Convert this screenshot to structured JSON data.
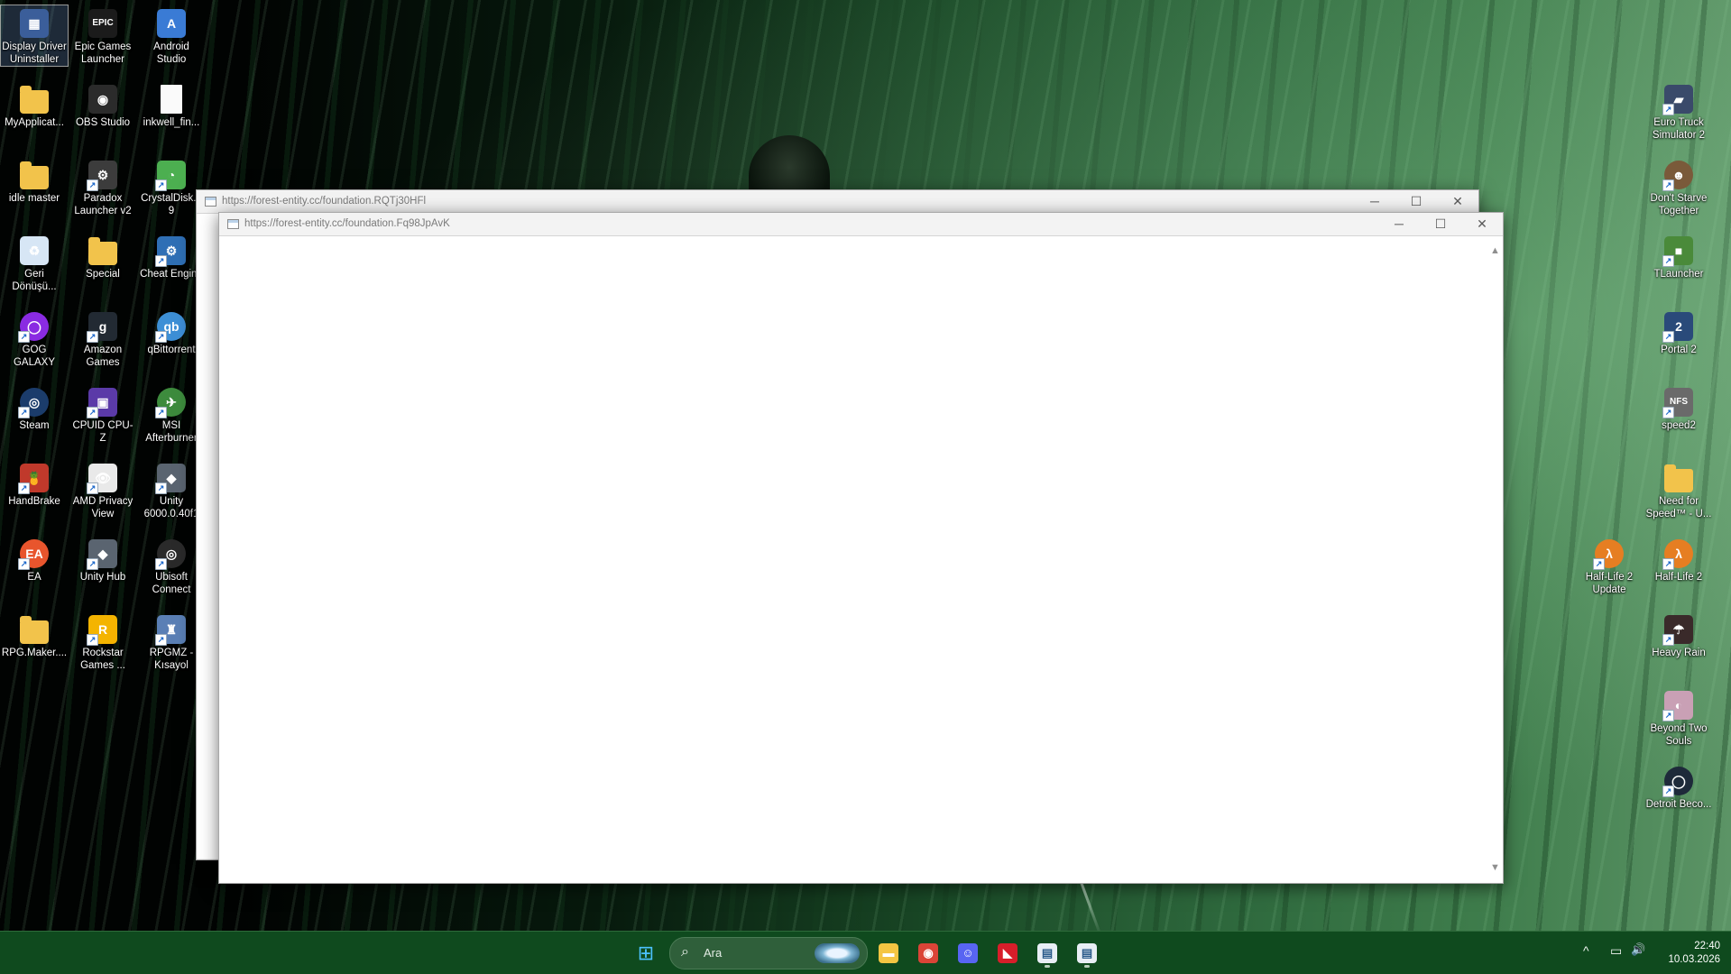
{
  "desktop": {
    "left_icons": [
      {
        "label": "Display Driver Uninstaller",
        "icon": "display-driver-uninstaller-icon",
        "color": "#3b5e9a",
        "glyph": "▦",
        "shortcut": false,
        "selected": true
      },
      {
        "label": "Epic Games Launcher",
        "icon": "epic-games-icon",
        "color": "#1b1b1b",
        "glyph": "EPIC",
        "shortcut": false
      },
      {
        "label": "Android Studio",
        "icon": "android-studio-icon",
        "color": "#3a7bd5",
        "glyph": "A",
        "shortcut": false
      },
      {
        "label": "MyApplicat...",
        "icon": "folder-icon",
        "color": "#f2c34b",
        "glyph": "",
        "folder": true
      },
      {
        "label": "OBS Studio",
        "icon": "obs-studio-icon",
        "color": "#2b2b2b",
        "glyph": "◉",
        "shortcut": false
      },
      {
        "label": "inkwell_fin...",
        "icon": "document-icon",
        "color": "#fafafa",
        "glyph": "",
        "doc": true
      },
      {
        "label": "idle master",
        "icon": "folder-icon",
        "color": "#f2c34b",
        "glyph": "",
        "folder": true
      },
      {
        "label": "Paradox Launcher v2",
        "icon": "paradox-launcher-icon",
        "color": "#3c3c3c",
        "glyph": "⚙",
        "shortcut": true
      },
      {
        "label": "CrystalDisk... 9",
        "icon": "crystaldiskinfo-icon",
        "color": "#4caf50",
        "glyph": "◔",
        "shortcut": true
      },
      {
        "label": "Geri Dönüşü...",
        "icon": "recycle-bin-icon",
        "color": "#d7e6f5",
        "glyph": "♻",
        "shortcut": false
      },
      {
        "label": "Special",
        "icon": "folder-icon",
        "color": "#f2c34b",
        "glyph": "",
        "folder": true
      },
      {
        "label": "Cheat Engine",
        "icon": "cheat-engine-icon",
        "color": "#2f6fb5",
        "glyph": "⚙",
        "shortcut": true
      },
      {
        "label": "GOG GALAXY",
        "icon": "gog-galaxy-icon",
        "color": "#8a2be2",
        "glyph": "◯",
        "shortcut": true,
        "round": true
      },
      {
        "label": "Amazon Games",
        "icon": "amazon-games-icon",
        "color": "#222a33",
        "glyph": "g",
        "shortcut": true
      },
      {
        "label": "qBittorrent",
        "icon": "qbittorrent-icon",
        "color": "#3d8fd6",
        "glyph": "qb",
        "shortcut": true,
        "round": true
      },
      {
        "label": "Steam",
        "icon": "steam-icon",
        "color": "#1b3c6b",
        "glyph": "◎",
        "shortcut": true,
        "round": true
      },
      {
        "label": "CPUID CPU-Z",
        "icon": "cpuz-icon",
        "color": "#5b3aa8",
        "glyph": "▣",
        "shortcut": true
      },
      {
        "label": "MSI Afterburner",
        "icon": "msi-afterburner-icon",
        "color": "#3d8b3d",
        "glyph": "✈",
        "shortcut": true,
        "round": true
      },
      {
        "label": "HandBrake",
        "icon": "handbrake-icon",
        "color": "#c0392b",
        "glyph": "🍍",
        "shortcut": true
      },
      {
        "label": "AMD Privacy View",
        "icon": "amd-privacy-view-icon",
        "color": "#e9e9e9",
        "glyph": "👁",
        "shortcut": true
      },
      {
        "label": "Unity 6000.0.40f1",
        "icon": "unity-icon",
        "color": "#5a6470",
        "glyph": "◆",
        "shortcut": true
      },
      {
        "label": "EA",
        "icon": "ea-icon",
        "color": "#e8552d",
        "glyph": "EA",
        "shortcut": true,
        "round": true
      },
      {
        "label": "Unity Hub",
        "icon": "unity-hub-icon",
        "color": "#5a6470",
        "glyph": "◆",
        "shortcut": true
      },
      {
        "label": "Ubisoft Connect",
        "icon": "ubisoft-connect-icon",
        "color": "#2a2a2a",
        "glyph": "◎",
        "shortcut": true,
        "round": true
      },
      {
        "label": "RPG.Maker....",
        "icon": "folder-icon",
        "color": "#f2c34b",
        "glyph": "",
        "folder": true
      },
      {
        "label": "Rockstar Games ...",
        "icon": "rockstar-games-icon",
        "color": "#f4b400",
        "glyph": "R",
        "shortcut": true
      },
      {
        "label": "RPGMZ - Kısayol",
        "icon": "rpgmz-icon",
        "color": "#5a7fb5",
        "glyph": "♜",
        "shortcut": true
      }
    ],
    "right_icons": [
      {
        "label": "Euro Truck Simulator 2",
        "icon": "euro-truck-simulator-icon",
        "color": "#3a4a6a",
        "glyph": "▰",
        "shortcut": true
      },
      {
        "label": "Don't Starve Together",
        "icon": "dont-starve-icon",
        "color": "#7a5a3a",
        "glyph": "☻",
        "shortcut": true,
        "round": true
      },
      {
        "label": "TLauncher",
        "icon": "tlauncher-icon",
        "color": "#4a8a3a",
        "glyph": "■",
        "shortcut": true
      },
      {
        "label": "Portal 2",
        "icon": "portal-2-icon",
        "color": "#2a4a7a",
        "glyph": "2",
        "shortcut": true
      },
      {
        "label": "speed2",
        "icon": "nfs-speed2-icon",
        "color": "#6a6a6a",
        "glyph": "NFS",
        "shortcut": true
      },
      {
        "label": "Need for Speed™ - U...",
        "icon": "folder-icon",
        "color": "#f2c34b",
        "glyph": "",
        "folder": true
      },
      {
        "label": "Half-Life 2 Update",
        "icon": "half-life-2-update-icon",
        "color": "#e67e22",
        "glyph": "λ",
        "shortcut": true,
        "round": true
      },
      {
        "label": "Half-Life 2",
        "icon": "half-life-2-icon",
        "color": "#e67e22",
        "glyph": "λ",
        "shortcut": true,
        "round": true
      },
      {
        "label": "Heavy Rain",
        "icon": "heavy-rain-icon",
        "color": "#3a2a2a",
        "glyph": "☂",
        "shortcut": true
      },
      {
        "label": "Beyond Two Souls",
        "icon": "beyond-two-souls-icon",
        "color": "#c9a0b5",
        "glyph": "◐",
        "shortcut": true
      },
      {
        "label": "Detroit Beco...",
        "icon": "detroit-become-human-icon",
        "color": "#1e2a3a",
        "glyph": "◯",
        "shortcut": true,
        "round": true
      }
    ]
  },
  "windows": {
    "back": {
      "title": "https://forest-entity.cc/foundation.RQTj30HFl"
    },
    "front": {
      "title": "https://forest-entity.cc/foundation.Fq98JpAvK"
    },
    "controls": {
      "minimize": "─",
      "maximize": "☐",
      "close": "✕"
    },
    "scroll_up": "▲",
    "scroll_down": "▼"
  },
  "taskbar": {
    "search_placeholder": "Ara",
    "search_glyph": "⌕",
    "start_glyph": "⊞",
    "apps": [
      {
        "name": "file-explorer-button",
        "icon": "file-explorer-icon",
        "color": "#f4c542",
        "glyph": "▬"
      },
      {
        "name": "chrome-button",
        "icon": "chrome-icon",
        "color": "#db4437",
        "glyph": "◉"
      },
      {
        "name": "discord-button",
        "icon": "discord-icon",
        "color": "#5865f2",
        "glyph": "☺"
      },
      {
        "name": "amd-software-button",
        "icon": "amd-software-icon",
        "color": "#d81e2a",
        "glyph": "◣"
      },
      {
        "name": "browser-window-1-button",
        "icon": "window-icon",
        "color": "#e8eef5",
        "glyph": "▤",
        "running": true
      },
      {
        "name": "browser-window-2-button",
        "icon": "window-icon",
        "color": "#e8eef5",
        "glyph": "▤",
        "running": true
      }
    ],
    "tray": {
      "chevron": "^",
      "network": "▭",
      "volume": "🔊"
    },
    "time": "22:40",
    "date": "10.03.2026"
  }
}
